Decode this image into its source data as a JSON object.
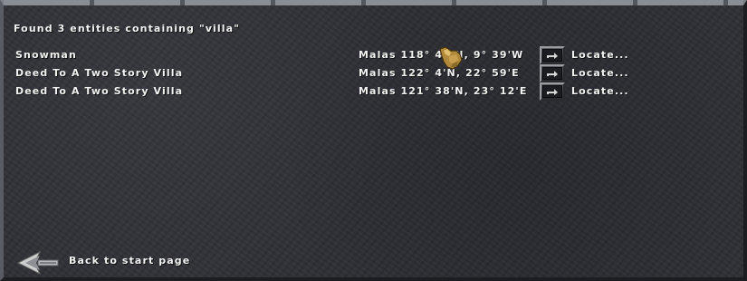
{
  "header": {
    "title": "Found 3 entities containing \"villa\""
  },
  "results": [
    {
      "name": "Snowman",
      "location": "Malas  118°  49'N,  9°  39'W",
      "locate_label": "Locate..."
    },
    {
      "name": "Deed To A Two Story Villa",
      "location": "Malas  122°  4'N,  22°  59'E",
      "locate_label": "Locate..."
    },
    {
      "name": "Deed To A Two Story Villa",
      "location": "Malas  121°  38'N,  23°  12'E",
      "locate_label": "Locate..."
    }
  ],
  "footer": {
    "back_label": "Back to start page"
  },
  "icons": {
    "locate": "arrow-right-icon",
    "back": "back-arrow-icon",
    "cursor": "gauntlet-cursor-icon"
  }
}
